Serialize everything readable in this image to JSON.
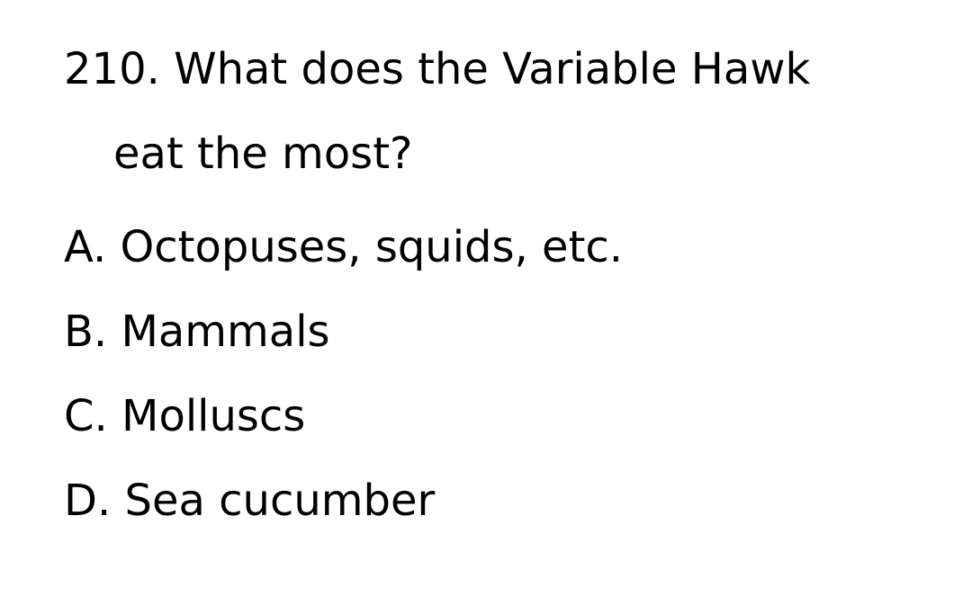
{
  "question": {
    "line1": "210. What does the Variable Hawk",
    "line2": "eat the most?"
  },
  "options": [
    {
      "label": "A. Octopuses, squids, etc."
    },
    {
      "label": "B. Mammals"
    },
    {
      "label": "C. Molluscs"
    },
    {
      "label": "D. Sea cucumber"
    }
  ]
}
